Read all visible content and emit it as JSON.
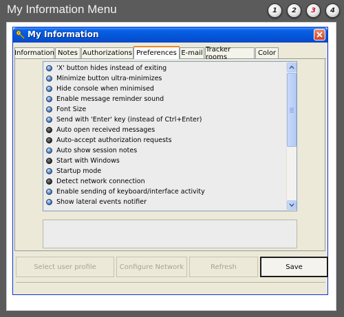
{
  "header": {
    "title": "My Information Menu",
    "pages": [
      {
        "label": "1",
        "active": false
      },
      {
        "label": "2",
        "active": false
      },
      {
        "label": "3",
        "active": true
      },
      {
        "label": "4",
        "active": false
      }
    ]
  },
  "window": {
    "title": "My Information",
    "tabs": [
      {
        "label": "Information",
        "active": false
      },
      {
        "label": "Notes",
        "active": false
      },
      {
        "label": "Authorizations",
        "active": false
      },
      {
        "label": "Preferences",
        "active": true
      },
      {
        "label": "E-mail",
        "active": false
      },
      {
        "label": "Tracker rooms",
        "active": false
      },
      {
        "label": "Color",
        "active": false
      }
    ],
    "preferences": [
      {
        "label": "'X' button hides instead of exiting",
        "state": "on"
      },
      {
        "label": "Minimize button ultra-minimizes",
        "state": "on"
      },
      {
        "label": "Hide console when minimised",
        "state": "on"
      },
      {
        "label": "Enable message reminder sound",
        "state": "on"
      },
      {
        "label": "Font Size",
        "state": "on"
      },
      {
        "label": "Send with 'Enter' key (instead of Ctrl+Enter)",
        "state": "on"
      },
      {
        "label": "Auto open received messages",
        "state": "off"
      },
      {
        "label": "Auto-accept authorization requests",
        "state": "off"
      },
      {
        "label": "Auto show session notes",
        "state": "on"
      },
      {
        "label": "Start with Windows",
        "state": "off"
      },
      {
        "label": "Startup mode",
        "state": "on"
      },
      {
        "label": "Detect network connection",
        "state": "off"
      },
      {
        "label": "Enable sending of keyboard/interface activity",
        "state": "on"
      },
      {
        "label": "Show lateral events notifier",
        "state": "on"
      }
    ],
    "buttons": {
      "select_profile": "Select user profile",
      "configure_network": "Configure Network",
      "refresh": "Refresh",
      "save": "Save"
    }
  },
  "colors": {
    "titlebar": "#0356d8",
    "active_tab_accent": "#e68b2c",
    "active_page": "#c8102e",
    "radio_on": "#4d83c6",
    "radio_off": "#3a3a3a"
  }
}
